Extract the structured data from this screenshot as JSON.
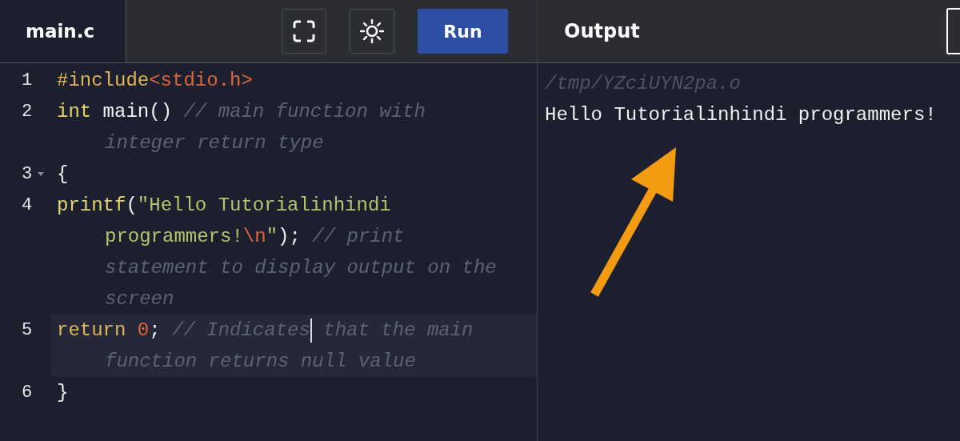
{
  "editor": {
    "tabs": [
      {
        "label": "main.c",
        "selected": true
      }
    ],
    "toolbar": [
      {
        "kind": "fullscreen"
      },
      {
        "kind": "theme"
      },
      {
        "kind": "run",
        "label": "Run"
      }
    ],
    "lines": [
      {
        "number": "1",
        "active": false,
        "rows": [
          {
            "tokens": [
              {
                "kind": "directive",
                "text": "#include"
              },
              {
                "kind": "header",
                "text": "<stdio.h>"
              }
            ]
          }
        ]
      },
      {
        "number": "2",
        "active": false,
        "rows": [
          {
            "tokens": [
              {
                "kind": "type",
                "text": "int"
              },
              {
                "kind": "plain",
                "text": " main() "
              },
              {
                "kind": "comment",
                "text": "// main function with"
              }
            ]
          },
          {
            "tokens": [
              {
                "kind": "comment",
                "text": "integer return type"
              }
            ]
          }
        ]
      },
      {
        "number": "3",
        "active": false,
        "fold": {
          "expanded": true
        },
        "rows": [
          {
            "tokens": [
              {
                "kind": "plain",
                "text": "{"
              }
            ]
          }
        ]
      },
      {
        "number": "4",
        "active": false,
        "rows": [
          {
            "tokens": [
              {
                "kind": "type",
                "text": "printf"
              },
              {
                "kind": "plain",
                "text": "("
              },
              {
                "kind": "string",
                "text": "\"Hello Tutorialinhindi"
              }
            ]
          },
          {
            "tokens": [
              {
                "kind": "string",
                "text": "programmers!"
              },
              {
                "kind": "escape",
                "text": "\\n"
              },
              {
                "kind": "string",
                "text": "\""
              },
              {
                "kind": "plain",
                "text": "); "
              },
              {
                "kind": "comment",
                "text": "// print"
              }
            ]
          },
          {
            "tokens": [
              {
                "kind": "comment",
                "text": "statement to display output on the"
              }
            ]
          },
          {
            "tokens": [
              {
                "kind": "comment",
                "text": "screen"
              }
            ]
          }
        ]
      },
      {
        "number": "5",
        "active": true,
        "rows": [
          {
            "tokens": [
              {
                "kind": "keyword",
                "text": "return "
              },
              {
                "kind": "number",
                "text": "0"
              },
              {
                "kind": "plain",
                "text": "; "
              },
              {
                "kind": "comment",
                "text": "// Indicates"
              },
              {
                "kind": "cursor"
              },
              {
                "kind": "comment",
                "text": " that the main"
              }
            ]
          },
          {
            "tokens": [
              {
                "kind": "comment",
                "text": "function returns null value"
              }
            ]
          }
        ]
      },
      {
        "number": "6",
        "active": false,
        "rows": [
          {
            "tokens": [
              {
                "kind": "plain",
                "text": "}"
              }
            ]
          }
        ]
      }
    ]
  },
  "output": {
    "title": "Output",
    "buttons": [
      {
        "kind": "edge"
      }
    ],
    "lines": [
      {
        "kind": "path",
        "text": "/tmp/YZciUYN2pa.o"
      },
      {
        "kind": "stdout",
        "text": "Hello Tutorialinhindi programmers!"
      }
    ]
  }
}
